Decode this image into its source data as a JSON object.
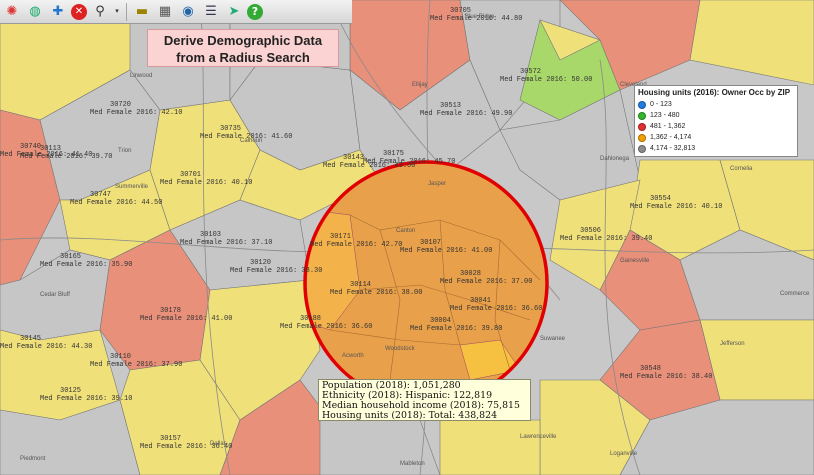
{
  "title": {
    "line1": "Derive Demographic Data",
    "line2": "from a Radius Search"
  },
  "toolbar": {
    "icons": [
      "color-wheel-icon",
      "globe-icon",
      "tools-icon",
      "delete-icon",
      "search-icon",
      "dropdown-arrow-icon",
      "ruler-icon",
      "data-icon",
      "web-globe-icon",
      "table-icon",
      "move-icon",
      "help-icon"
    ]
  },
  "legend": {
    "title": "Housing units (2016): Owner Occ by ZIP",
    "items": [
      {
        "range": "0 - 123",
        "color": "#1f7de0"
      },
      {
        "range": "123 - 480",
        "color": "#34b52e"
      },
      {
        "range": "481 - 1,362",
        "color": "#e03030"
      },
      {
        "range": "1,362 - 4,174",
        "color": "#f0a000"
      },
      {
        "range": "4,174 - 32,813",
        "color": "#8c8c8c"
      }
    ]
  },
  "stats": {
    "population": "Population (2018): 1,051,280",
    "ethnicity": "Ethnicity (2018): Hispanic: 122,819",
    "income": "Median household income (2018): 75,815",
    "housing": "Housing units (2018): Total: 438,824"
  },
  "colors": {
    "radius_circle": "#e00000",
    "radius_fill": "#e8a04a",
    "salmon": "#e8907a",
    "yellow": "#efe07a",
    "light_gray": "#c6c6c6",
    "green": "#a8d86a"
  },
  "map_labels": [
    {
      "zip": "30171",
      "metric": "Med Female 2016:  42.70"
    },
    {
      "zip": "30107",
      "metric": "Med Female 2016:  41.00"
    },
    {
      "zip": "30028",
      "metric": "Med Female 2016:  37.00"
    },
    {
      "zip": "30114",
      "metric": "Med Female 2016:  38.00"
    },
    {
      "zip": "30041",
      "metric": "Med Female 2016:  36.60"
    },
    {
      "zip": "30188",
      "metric": "Med Female 2016:  36.60"
    },
    {
      "zip": "30004",
      "metric": "Med Female 2016:  39.80"
    },
    {
      "zip": "30143",
      "metric": "Med Female 2016:  43.00"
    },
    {
      "zip": "30175",
      "metric": "Med Female 2016:  45.70"
    },
    {
      "zip": "30705",
      "metric": "Med Female 2016:  44.80"
    },
    {
      "zip": "30735",
      "metric": "Med Female 2016:  41.60"
    },
    {
      "zip": "30720",
      "metric": "Med Female 2016:  42.10"
    },
    {
      "zip": "30701",
      "metric": "Med Female 2016:  40.10"
    },
    {
      "zip": "30103",
      "metric": "Med Female 2016:  37.10"
    },
    {
      "zip": "30165",
      "metric": "Med Female 2016:  35.90"
    },
    {
      "zip": "30145",
      "metric": "Med Female 2016:  44.30"
    },
    {
      "zip": "30572",
      "metric": "Med Female 2016:  50.00"
    },
    {
      "zip": "30513",
      "metric": "Med Female 2016:  49.90"
    },
    {
      "zip": "30506",
      "metric": "Med Female 2016:  39.40"
    },
    {
      "zip": "30554",
      "metric": "Med Female 2016:  40.10"
    },
    {
      "zip": "30120",
      "metric": "Med Female 2016:  38.30"
    },
    {
      "zip": "30157",
      "metric": "Med Female 2016:  36.40"
    },
    {
      "zip": "30548",
      "metric": "Med Female 2016:  38.40"
    },
    {
      "zip": "30113",
      "metric": "Med Female 2016:  39.70"
    },
    {
      "zip": "30740",
      "metric": "Med Female 2016:  41.40"
    },
    {
      "zip": "30747",
      "metric": "Med Female 2016:  44.50"
    },
    {
      "zip": "30125",
      "metric": "Med Female 2016:  39.10"
    },
    {
      "zip": "30178",
      "metric": "Med Female 2016:  41.00"
    },
    {
      "zip": "30110",
      "metric": "Med Female 2016:  37.90"
    }
  ],
  "city_labels": [
    "Jasper",
    "Calhoun",
    "Summerville",
    "Trion",
    "Linwood",
    "Ellijay",
    "Blue Ridge",
    "Dahlonega",
    "Cleveland",
    "Gainesville",
    "Commerce",
    "Jefferson",
    "Cedar Bluff",
    "Piedmont",
    "Woodstock",
    "Canton",
    "Cornelia",
    "Acworth",
    "Dallas",
    "Lawrenceville",
    "Loganville",
    "Mableton",
    "Suwanee"
  ]
}
